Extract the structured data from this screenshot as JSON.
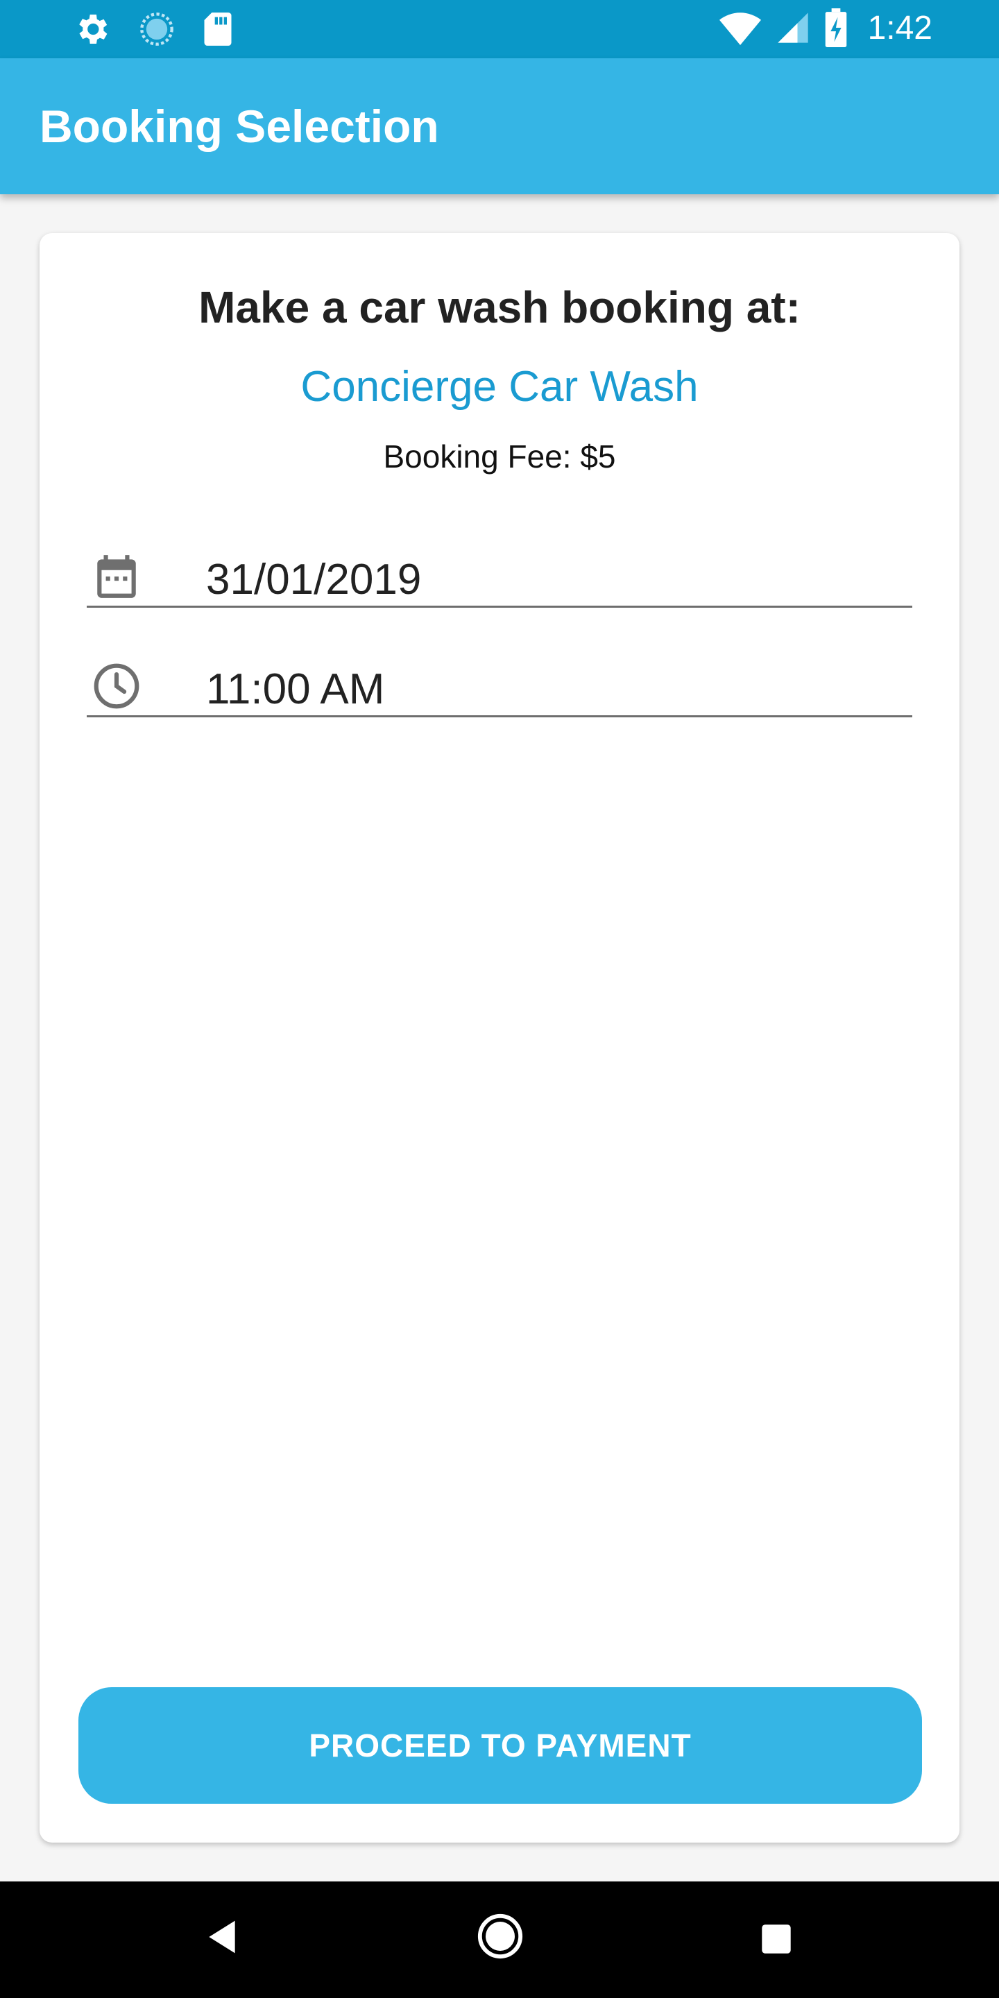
{
  "status_bar": {
    "time": "1:42",
    "left_icons": [
      "settings-icon",
      "sync-icon",
      "sd-card-icon"
    ],
    "right_icons": [
      "wifi-icon",
      "signal-icon",
      "battery-charging-icon"
    ]
  },
  "app_bar": {
    "title": "Booking Selection"
  },
  "booking": {
    "heading": "Make a car wash booking at:",
    "venue": "Concierge Car Wash",
    "fee": "Booking Fee: $5",
    "date": "31/01/2019",
    "time": "11:00 AM",
    "proceed_label": "PROCEED TO PAYMENT"
  },
  "nav_bar": {
    "buttons": [
      "back-icon",
      "home-icon",
      "recents-icon"
    ]
  },
  "colors": {
    "status_bar": "#0a98c8",
    "app_bar": "#35b5e5",
    "accent_text": "#1a9bd1",
    "button": "#35b5e5"
  }
}
